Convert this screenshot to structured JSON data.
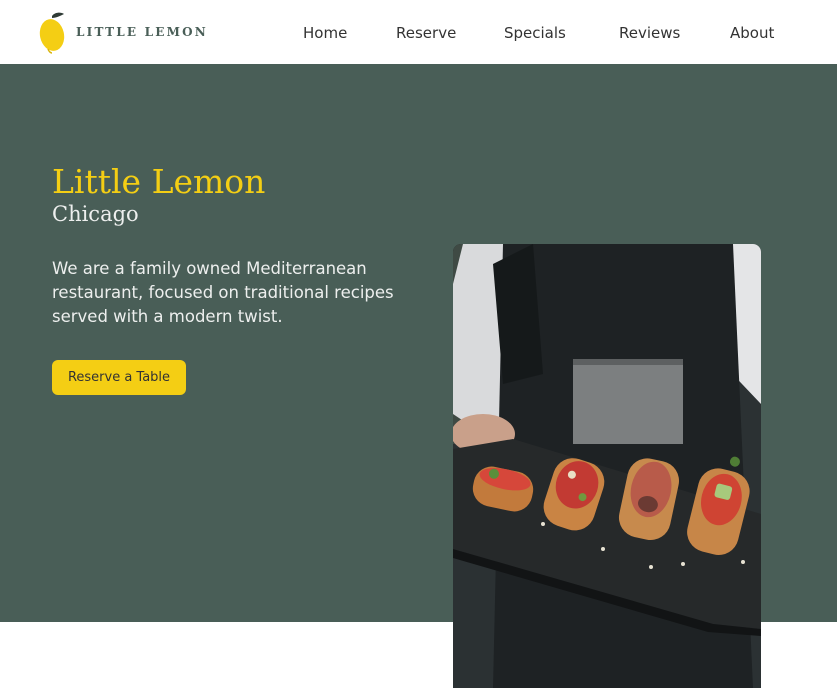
{
  "brand": {
    "name": "LITTLE LEMON",
    "accent_color": "#f4ce14",
    "primary_color": "#495e57",
    "logo_icon": "lemon-icon"
  },
  "nav": {
    "items": [
      {
        "label": "Home"
      },
      {
        "label": "Reserve"
      },
      {
        "label": "Specials"
      },
      {
        "label": "Reviews"
      },
      {
        "label": "About"
      }
    ]
  },
  "hero": {
    "title": "Little Lemon",
    "subtitle": "Chicago",
    "description": "We are a family owned Mediterranean restaurant, focused on traditional recipes served with a modern twist.",
    "cta_label": "Reserve a Table",
    "image_subject": "chef holding slate tray of bruschetta"
  }
}
